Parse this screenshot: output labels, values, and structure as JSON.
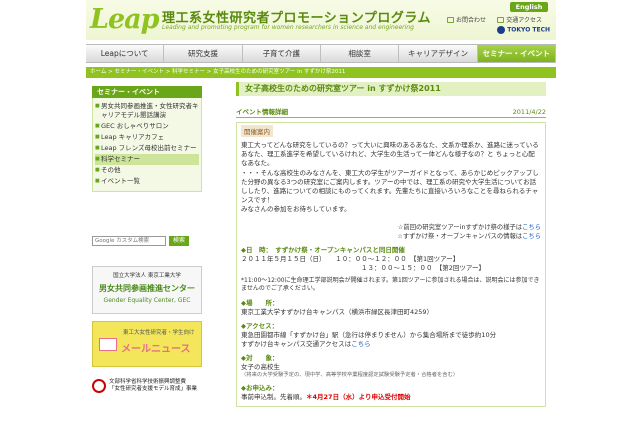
{
  "header": {
    "logo": "Leap",
    "title": "理工系女性研究者プロモーションプログラム",
    "subtitle": "Leading and promoting program for women researchers in science and engineering",
    "english_button": "English",
    "inquiry": "お問合わせ",
    "access": "交通アクセス",
    "university": "TOKYO TECH"
  },
  "nav": {
    "items": [
      "Leapについて",
      "研究支援",
      "子育て介護",
      "相談室",
      "キャリアデザイン",
      "セミナー・イベント"
    ]
  },
  "breadcrumb": "ホーム > セミナー・イベント > 科学セミナー > 女子高校生のための研究室ツアー in すずかけ祭2011",
  "sidebar": {
    "heading": "セミナー・イベント",
    "items": [
      "男女共同参画推進・女性研究者キャリアモデル懇話講演",
      "GEC おしゃべりサロン",
      "Leap キャリアカフェ",
      "Leap フレンズ母校出前セミナー",
      "科学セミナー",
      "その他",
      "イベント一覧"
    ],
    "search_placeholder": "Google カスタム検索",
    "search_button": "検索"
  },
  "banners": {
    "gec_line1": "国立大学法人 東京工業大学",
    "gec_line2": "男女共同参画推進センター",
    "gec_line3": "Gender Equality Center, GEC",
    "mail_line1": "東工大女性研究者・学生向け",
    "mail_line2": "メールニュース",
    "mext_line1": "文部科学省科学技術振興調整費",
    "mext_line2": "「女性研究者支援モデル育成」事業"
  },
  "article": {
    "title": "女子高校生のための研究室ツアー in すずかけ祭2011",
    "info_label": "イベント情報詳細",
    "date": "2011/4/22",
    "box_heading": "開催案内",
    "paragraph1": "東工大ってどんな研究をしているの？って大いに興味のあるあなた、文系か理系か、進路に迷っているあなた、理工系進学を希望しているけれど、大学生の生活って一体どんな様子なの？と ちょっと心配なあなた。",
    "paragraph2": "・・・そんな高校生のみなさんを、東工大の学生がツアーガイドとなって、あらかじめピックアップした分野の異なる3つの研究室にご案内します。ツアーの中では、理工系の研究や大学生活についてお話ししたり、進路についての相談にものってくれます。先輩たちに直接いろいろなことを尋ねられるチャンスです！",
    "paragraph3": "みなさんの参加をお待ちしています。",
    "prev_tour": "☆前回の研究室ツアーinすずかけ祭の様子は",
    "prev_tour_link": "こちら",
    "open_campus": "☆すずかけ祭・オープンキャンパスの情報は",
    "open_campus_link": "こちら",
    "date_head": "◆日　時：　すずかけ祭・オープンキャンパスと同日開催",
    "date_line1": "２０１１年５月１５日（日）　　１０：００～１２：００　【第1回ツアー】",
    "date_line2": "１３：００～１５：００　【第2回ツアー】",
    "date_note": "*11:00～12:00に生命理工学部説明会が開催されます。第1回ツアーに参加される場合は、説明会には参加できませんのでご了承ください。",
    "place_head": "◆場　　所：",
    "place_body": "東京工業大学すずかけ台キャンパス（横浜市緑区長津田町4259）",
    "access_head": "◆アクセス：",
    "access_body1": "東急田園都市線「すずかけ台」駅（急行は停まりません）から集合場所まで徒歩約10分",
    "access_body2": "すずかけ台キャンパス交通アクセスは",
    "access_link": "こちら",
    "target_head": "◆対　　象：",
    "target_body": "女子の高校生",
    "target_note": "（将来の大学受験予定の、現中学、高等学校卒業程度認定試験受験予定者・合格者を含む）",
    "apply_head": "◆お申込み：",
    "apply_body": "事前申込制。先着順。",
    "apply_deadline": "＊4月27日（水）より申込受付開始"
  }
}
